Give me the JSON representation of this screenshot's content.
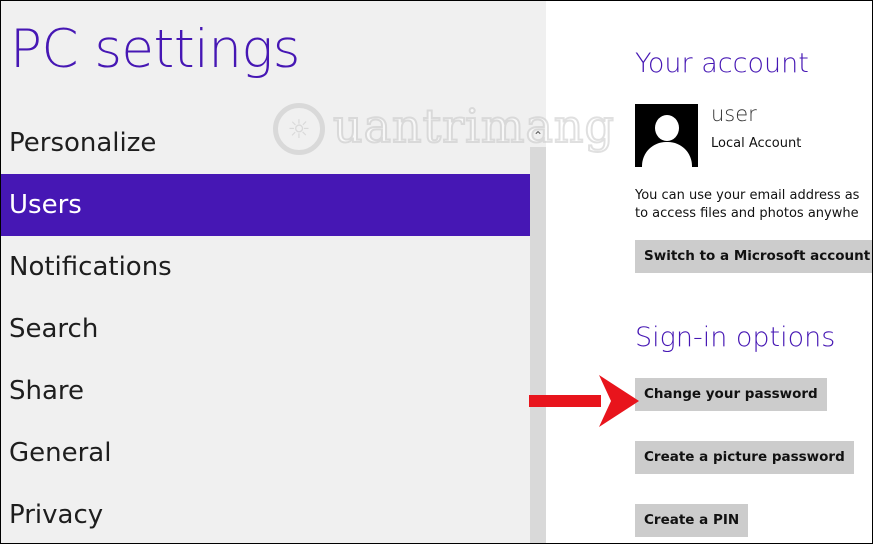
{
  "app": {
    "title": "PC settings"
  },
  "nav": {
    "items": [
      {
        "label": "Personalize",
        "selected": false
      },
      {
        "label": "Users",
        "selected": true
      },
      {
        "label": "Notifications",
        "selected": false
      },
      {
        "label": "Search",
        "selected": false
      },
      {
        "label": "Share",
        "selected": false
      },
      {
        "label": "General",
        "selected": false
      },
      {
        "label": "Privacy",
        "selected": false
      }
    ]
  },
  "account": {
    "heading": "Your account",
    "user_name": "user",
    "account_type": "Local Account",
    "info_line1": "You can use your email address as",
    "info_line2": "to access files and photos anywhe",
    "switch_button": "Switch to a Microsoft account"
  },
  "signin": {
    "heading": "Sign-in options",
    "change_password": "Change your password",
    "picture_password": "Create a picture password",
    "pin": "Create a PIN"
  },
  "watermark": {
    "text": "uantrimang"
  },
  "colors": {
    "accent": "#4617b4",
    "left_bg": "#f0f0f0",
    "button_bg": "#cccccc",
    "arrow": "#e8141c"
  }
}
